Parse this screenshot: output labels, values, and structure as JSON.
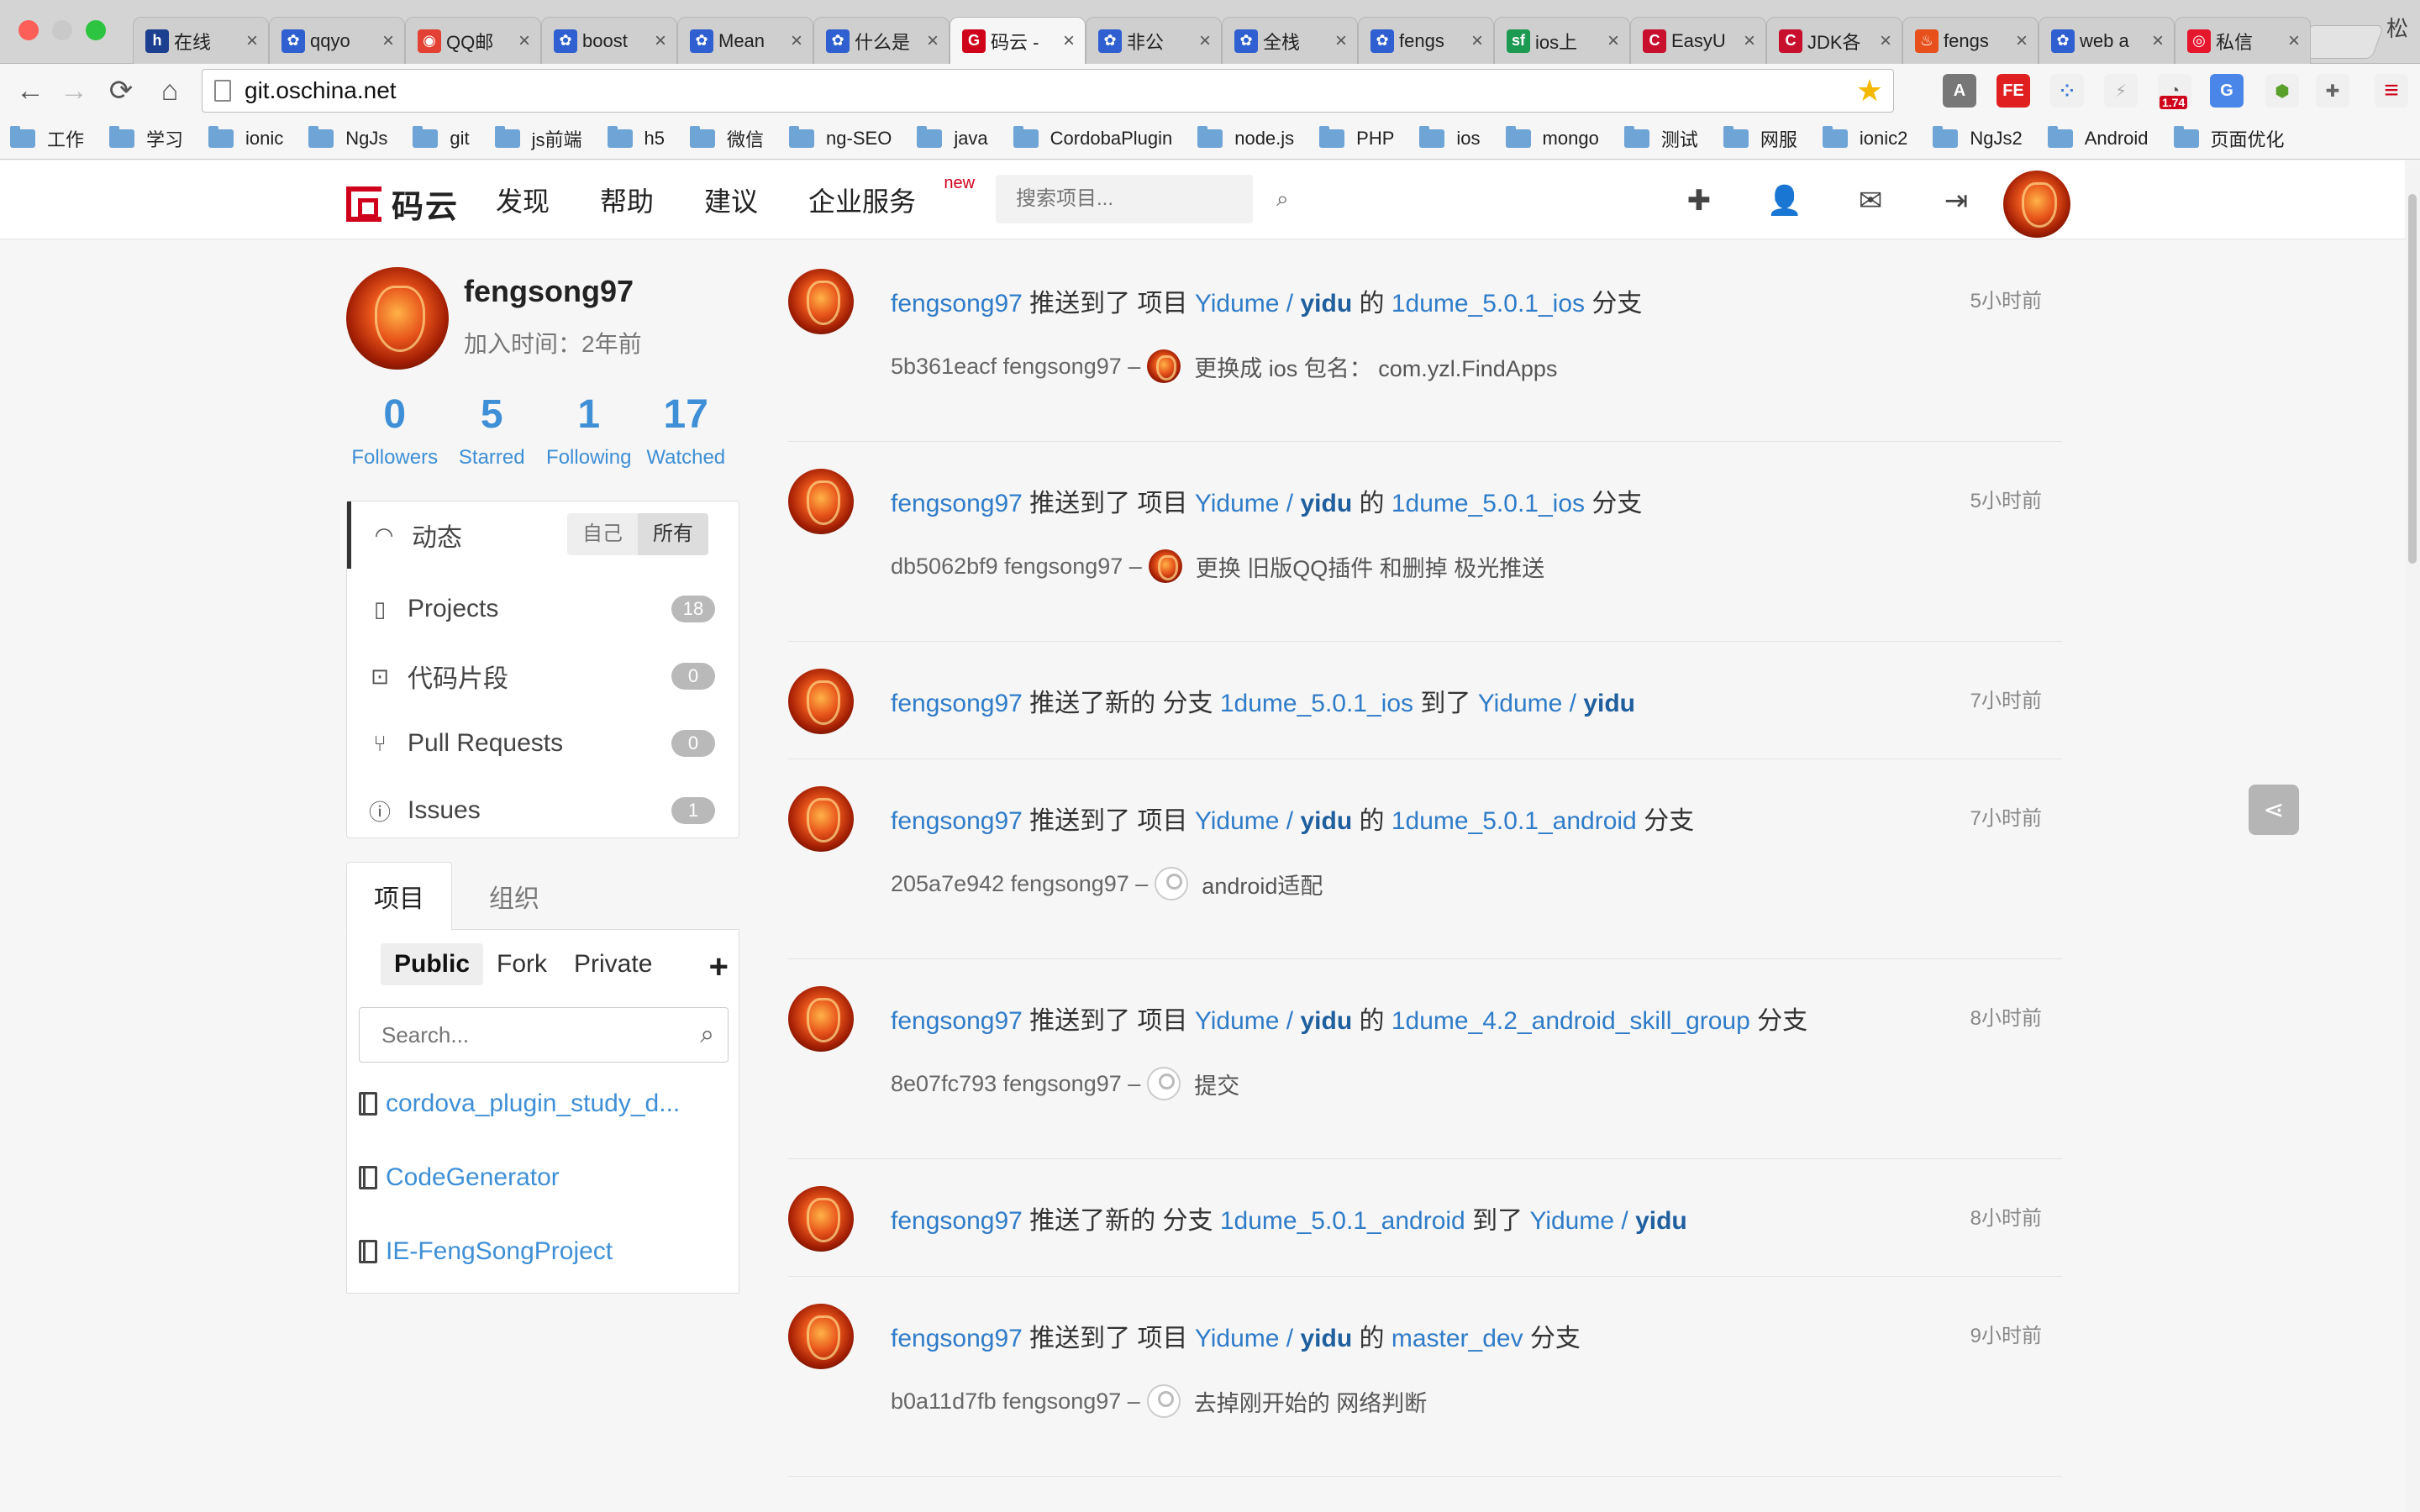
{
  "browser": {
    "tabs": [
      {
        "label": "在线",
        "favicon": "h",
        "color": "#1c3f8f"
      },
      {
        "label": "qqyo",
        "favicon": "baidu-paw",
        "color": "#2f5fd0"
      },
      {
        "label": "QQ邮",
        "favicon": "chrome",
        "color": "#e34133"
      },
      {
        "label": "boost",
        "favicon": "baidu-paw",
        "color": "#2f5fd0"
      },
      {
        "label": "Mean",
        "favicon": "baidu-paw",
        "color": "#2f5fd0"
      },
      {
        "label": "什么是",
        "favicon": "baidu-paw",
        "color": "#2f5fd0"
      },
      {
        "label": "码云 -",
        "favicon": "gitee",
        "color": "#d0021b"
      },
      {
        "label": "非公",
        "favicon": "baidu-paw",
        "color": "#2f5fd0"
      },
      {
        "label": "全栈",
        "favicon": "baidu-paw",
        "color": "#2f5fd0"
      },
      {
        "label": "fengs",
        "favicon": "baidu-paw",
        "color": "#2f5fd0"
      },
      {
        "label": "ios上",
        "favicon": "sf",
        "color": "#1d9a52"
      },
      {
        "label": "EasyU",
        "favicon": "C",
        "color": "#c8102e"
      },
      {
        "label": "JDK各",
        "favicon": "C",
        "color": "#c8102e"
      },
      {
        "label": "fengs",
        "favicon": "flame",
        "color": "#e8501b"
      },
      {
        "label": "web a",
        "favicon": "baidu-paw",
        "color": "#2f5fd0"
      },
      {
        "label": "私信",
        "favicon": "weibo",
        "color": "#e6162d"
      }
    ],
    "active_tab_index": 6,
    "corner_label": "松",
    "url": "git.oschina.net",
    "bookmarks": [
      "工作",
      "学习",
      "ionic",
      "NgJs",
      "git",
      "js前端",
      "h5",
      "微信",
      "ng-SEO",
      "java",
      "CordobaPlugin",
      "node.js",
      "PHP",
      "ios",
      "mongo",
      "测试",
      "网服",
      "ionic2",
      "NgJs2",
      "Android",
      "页面优化"
    ],
    "extension_badge": "1.74"
  },
  "site": {
    "logo_text": "码云",
    "nav": [
      "发现",
      "帮助",
      "建议",
      "企业服务"
    ],
    "nav_new_badge": "new",
    "search_placeholder": "搜索项目...",
    "accent": "#d0021b",
    "link_color": "#2f7cc9"
  },
  "profile": {
    "username": "fengsong97",
    "joined_label": "加入时间：",
    "joined_value": "2年前",
    "stats": [
      {
        "value": "0",
        "label": "Followers"
      },
      {
        "value": "5",
        "label": "Starred"
      },
      {
        "value": "1",
        "label": "Following"
      },
      {
        "value": "17",
        "label": "Watched"
      }
    ]
  },
  "menu": {
    "activity_label": "动态",
    "toggle": [
      "自己",
      "所有"
    ],
    "items": [
      {
        "label": "Projects",
        "count": "18",
        "icon": "book-icon"
      },
      {
        "label": "代码片段",
        "count": "0",
        "icon": "code-icon"
      },
      {
        "label": "Pull Requests",
        "count": "0",
        "icon": "pull-request-icon"
      },
      {
        "label": "Issues",
        "count": "1",
        "icon": "exclamation-icon"
      }
    ]
  },
  "projects": {
    "tabs": [
      "项目",
      "组织"
    ],
    "filters": [
      "Public",
      "Fork",
      "Private"
    ],
    "search_placeholder": "Search...",
    "list": [
      "cordova_plugin_study_d...",
      "CodeGenerator",
      "IE-FengSongProject"
    ]
  },
  "feed": [
    {
      "user": "fengsong97",
      "verb": "推送到了 项目",
      "owner": "Yidume / ",
      "repo": "yidu",
      "mid": "的",
      "branch": "1dume_5.0.1_ios",
      "tail": "分支",
      "time": "5小时前",
      "commit": "5b361eacf fengsong97 –",
      "msg": "更换成 ios 包名：  com.yzl.FindApps",
      "mini": "fire"
    },
    {
      "user": "fengsong97",
      "verb": "推送到了 项目",
      "owner": "Yidume / ",
      "repo": "yidu",
      "mid": "的",
      "branch": "1dume_5.0.1_ios",
      "tail": "分支",
      "time": "5小时前",
      "commit": "db5062bf9 fengsong97 –",
      "msg": "更换 旧版QQ插件 和删掉 极光推送",
      "mini": "fire"
    },
    {
      "user": "fengsong97",
      "verb": "推送了新的 分支",
      "owner": "",
      "repo": "",
      "mid": "",
      "branch": "1dume_5.0.1_ios",
      "tail": "到了",
      "owner2": "Yidume / ",
      "repo2": "yidu",
      "time": "7小时前"
    },
    {
      "user": "fengsong97",
      "verb": "推送到了 项目",
      "owner": "Yidume / ",
      "repo": "yidu",
      "mid": "的",
      "branch": "1dume_5.0.1_android",
      "tail": "分支",
      "time": "7小时前",
      "commit": "205a7e942 fengsong97 –",
      "msg": "android适配",
      "mini": "blank"
    },
    {
      "user": "fengsong97",
      "verb": "推送到了 项目",
      "owner": "Yidume / ",
      "repo": "yidu",
      "mid": "的",
      "branch": "1dume_4.2_android_skill_group",
      "tail": "分支",
      "time": "8小时前",
      "commit": "8e07fc793 fengsong97 –",
      "msg": "提交",
      "mini": "blank"
    },
    {
      "user": "fengsong97",
      "verb": "推送了新的 分支",
      "owner": "",
      "repo": "",
      "mid": "",
      "branch": "1dume_5.0.1_android",
      "tail": "到了",
      "owner2": "Yidume / ",
      "repo2": "yidu",
      "time": "8小时前"
    },
    {
      "user": "fengsong97",
      "verb": "推送到了 项目",
      "owner": "Yidume / ",
      "repo": "yidu",
      "mid": "的",
      "branch": "master_dev",
      "tail": "分支",
      "time": "9小时前",
      "commit": "b0a11d7fb fengsong97 –",
      "msg": "去掉刚开始的 网络判断",
      "mini": "blank"
    }
  ]
}
